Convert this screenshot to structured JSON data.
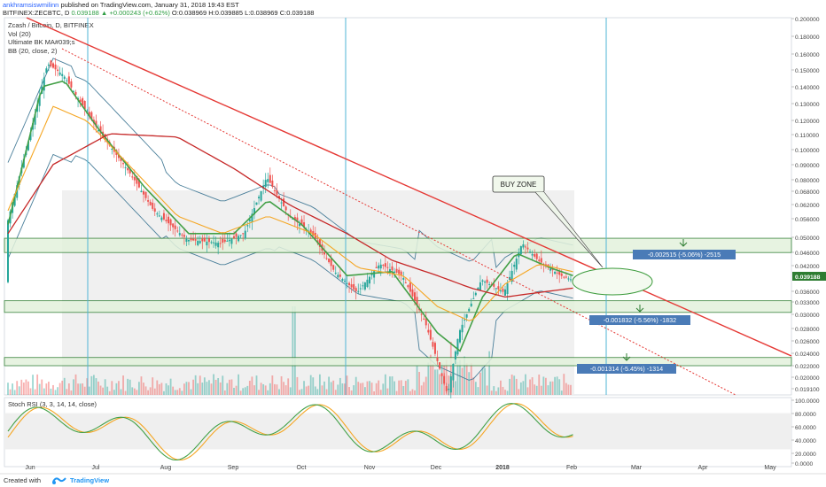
{
  "header": {
    "author": "ankhramsiswmilinn",
    "published_text": " published on TradingView.com, January 31, 2018 19:43 EST",
    "symbol": "BITFINEX:ZECBTC, D",
    "last": "0.039188",
    "change": "+0.000243 (+0.62%)",
    "ohlc": "O:0.038969 H:0.039885 L:0.038969 C:0.039188"
  },
  "legend": {
    "line1": "Zcash / Bitcoin, D, BITFINEX",
    "line2": "Vol (20)",
    "line3": "Ultimate BK MA#039;s",
    "line4": "BB (20, close, 2)"
  },
  "annotations": {
    "buy_zone": "BUY ZONE",
    "target1": "-0.002515 (-5.06%) -2515",
    "target2": "-0.001832 (-5.56%) -1832",
    "target3": "-0.001314 (-5.45%) -1314"
  },
  "rsi_label": "Stoch RSI (3, 3, 14, 14, close)",
  "footer": {
    "created_with": "Created with",
    "brand": "TradingView"
  },
  "colors": {
    "trendline": "#e53935",
    "ema_fast": "#43a047",
    "ema_mid": "#f5a623",
    "sma_slow": "#c62828",
    "bb": "#4a7f9a",
    "zone_fill": "#e3f2dc",
    "zone_border": "#2e7d32",
    "up_candle": "#26a69a",
    "down_candle": "#ef5350",
    "vline": "#4fb5d6",
    "label_bg": "#4a7bb7",
    "last_price_bg": "#2e7d32"
  },
  "chart_data": {
    "type": "candlestick",
    "title": "Zcash / Bitcoin, D, BITFINEX",
    "y_scale": "log",
    "x_ticks": [
      "Jun",
      "Jul",
      "Aug",
      "Sep",
      "Oct",
      "Nov",
      "Dec",
      "2018",
      "Feb",
      "Mar",
      "Apr",
      "May"
    ],
    "y_ticks": [
      "0.200000",
      "0.180000",
      "0.160000",
      "0.150000",
      "0.140000",
      "0.130000",
      "0.120000",
      "0.110000",
      "0.100000",
      "0.090000",
      "0.080000",
      "0.068000",
      "0.062000",
      "0.056000",
      "0.050000",
      "0.046000",
      "0.042000",
      "0.036000",
      "0.033000",
      "0.030000",
      "0.028000",
      "0.026000",
      "0.024000",
      "0.022000",
      "0.020000",
      "0.019100"
    ],
    "last_price": "0.039188",
    "support_zones": [
      [
        0.0462,
        0.0505
      ],
      [
        0.0318,
        0.0342
      ],
      [
        0.0228,
        0.024
      ]
    ],
    "trendlines": [
      {
        "style": "solid"
      },
      {
        "style": "dotted"
      }
    ],
    "series": [
      {
        "name": "price",
        "approx_path": [
          [
            0,
            0.055
          ],
          [
            10,
            0.095
          ],
          [
            18,
            0.15
          ],
          [
            25,
            0.14
          ],
          [
            40,
            0.1
          ],
          [
            55,
            0.075
          ],
          [
            65,
            0.06
          ],
          [
            80,
            0.05
          ],
          [
            95,
            0.049
          ],
          [
            105,
            0.052
          ],
          [
            115,
            0.074
          ],
          [
            125,
            0.058
          ],
          [
            135,
            0.052
          ],
          [
            145,
            0.041
          ],
          [
            155,
            0.036
          ],
          [
            165,
            0.043
          ],
          [
            175,
            0.04
          ],
          [
            185,
            0.03
          ],
          [
            190,
            0.024
          ],
          [
            195,
            0.019
          ],
          [
            200,
            0.028
          ],
          [
            210,
            0.039
          ],
          [
            220,
            0.036
          ],
          [
            228,
            0.049
          ],
          [
            235,
            0.044
          ],
          [
            245,
            0.04
          ],
          [
            250,
            0.039
          ]
        ]
      },
      {
        "name": "ema_fast",
        "approx_path": [
          [
            0,
            0.055
          ],
          [
            15,
            0.13
          ],
          [
            25,
            0.135
          ],
          [
            40,
            0.1
          ],
          [
            60,
            0.07
          ],
          [
            80,
            0.052
          ],
          [
            100,
            0.052
          ],
          [
            115,
            0.064
          ],
          [
            130,
            0.055
          ],
          [
            150,
            0.04
          ],
          [
            170,
            0.041
          ],
          [
            190,
            0.028
          ],
          [
            200,
            0.025
          ],
          [
            210,
            0.035
          ],
          [
            225,
            0.046
          ],
          [
            240,
            0.042
          ],
          [
            250,
            0.04
          ]
        ]
      },
      {
        "name": "ema_mid",
        "approx_path": [
          [
            0,
            0.06
          ],
          [
            20,
            0.115
          ],
          [
            35,
            0.105
          ],
          [
            55,
            0.078
          ],
          [
            75,
            0.058
          ],
          [
            95,
            0.052
          ],
          [
            115,
            0.058
          ],
          [
            135,
            0.052
          ],
          [
            155,
            0.042
          ],
          [
            175,
            0.04
          ],
          [
            190,
            0.033
          ],
          [
            205,
            0.03
          ],
          [
            220,
            0.038
          ],
          [
            235,
            0.043
          ],
          [
            250,
            0.041
          ]
        ]
      },
      {
        "name": "sma_slow",
        "approx_path": [
          [
            0,
            0.052
          ],
          [
            20,
            0.08
          ],
          [
            45,
            0.097
          ],
          [
            75,
            0.095
          ],
          [
            100,
            0.078
          ],
          [
            125,
            0.062
          ],
          [
            150,
            0.052
          ],
          [
            170,
            0.044
          ],
          [
            190,
            0.04
          ],
          [
            205,
            0.037
          ],
          [
            220,
            0.035
          ],
          [
            235,
            0.036
          ],
          [
            250,
            0.037
          ]
        ]
      }
    ],
    "oscillator": {
      "name": "Stoch RSI (3, 3, 14, 14, close)",
      "y_ticks": [
        "100.0000",
        "80.0000",
        "60.0000",
        "40.0000",
        "20.0000",
        "0.0000"
      ],
      "ylim": [
        0,
        100
      ]
    }
  }
}
